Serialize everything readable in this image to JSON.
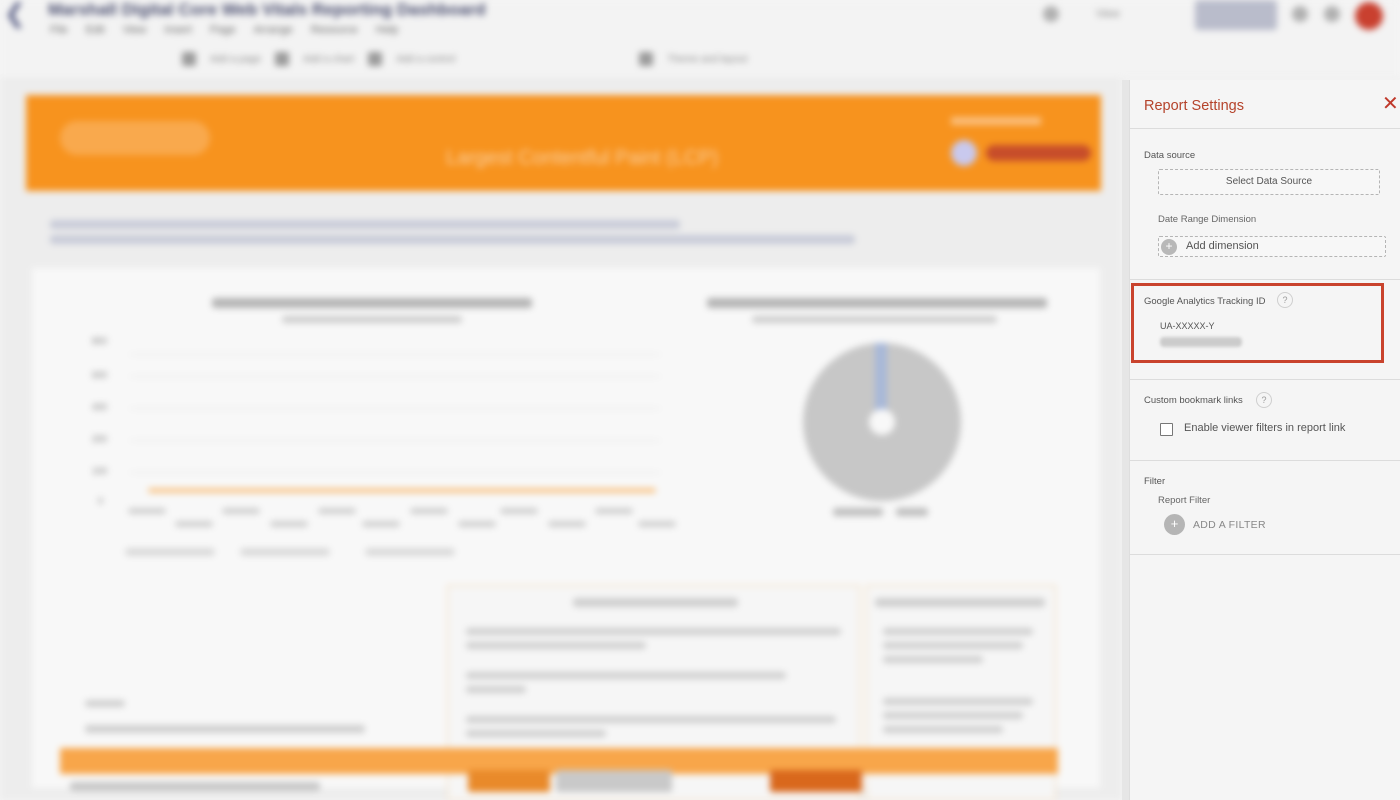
{
  "background_app": {
    "doc_title": "Marshall Digital Core Web Vitals Reporting Dashboard",
    "menus": [
      "File",
      "Edit",
      "View",
      "Insert",
      "Page",
      "Arrange",
      "Resource",
      "Help"
    ],
    "toolbar": [
      "Add a page",
      "Add a chart",
      "Add a control",
      "Theme and layout"
    ],
    "view_label": "View",
    "banner_title": "Largest Contentful Paint (LCP)"
  },
  "settings_panel": {
    "title": "Report Settings",
    "close_icon": "close-icon",
    "data_source_label": "Data source",
    "select_data_source": "Select Data Source",
    "date_range_label": "Date Range Dimension",
    "add_dimension": "Add dimension",
    "ga_label": "Google Analytics Tracking ID",
    "ga_help": "?",
    "ga_value": "UA-XXXXX-Y",
    "bookmark_label": "Custom bookmark links",
    "bookmark_help": "?",
    "enable_viewer_filters": "Enable viewer filters in report link",
    "filter_label": "Filter",
    "report_filter_label": "Report Filter",
    "add_filter": "ADD A FILTER",
    "plus_glyph": "+"
  },
  "colors": {
    "accent": "#b5432b",
    "highlight_border": "#c9432d",
    "banner_orange": "#f7931e"
  }
}
